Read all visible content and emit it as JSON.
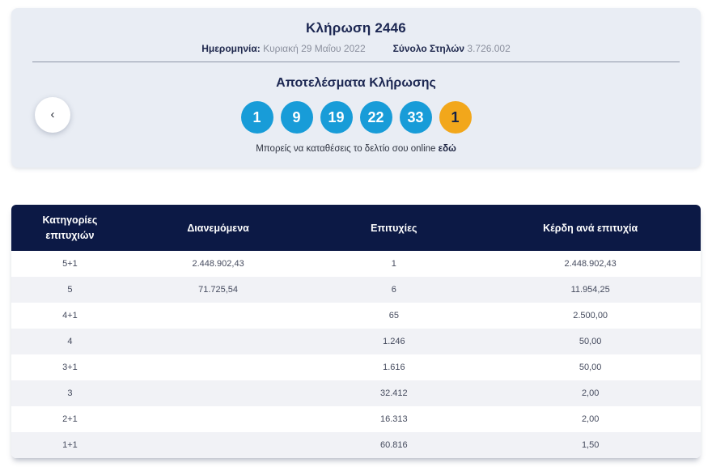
{
  "colors": {
    "navy": "#0c1945",
    "ball_blue": "#189cd8",
    "ball_orange": "#f2a71b",
    "hero_background": "#e9edf4",
    "row_alternate": "#f1f2f6"
  },
  "hero": {
    "title": "Κλήρωση 2446",
    "date_label": "Ημερομηνία:",
    "date_value": "Κυριακή 29 Μαΐου 2022",
    "columns_label": "Σύνολο Στηλών",
    "columns_value": "3.726.002",
    "results_title": "Αποτελέσματα Κλήρωσης",
    "numbers": [
      {
        "value": "1",
        "type": "main"
      },
      {
        "value": "9",
        "type": "main"
      },
      {
        "value": "19",
        "type": "main"
      },
      {
        "value": "22",
        "type": "main"
      },
      {
        "value": "33",
        "type": "main"
      },
      {
        "value": "1",
        "type": "joker"
      }
    ],
    "online_text": "Μπορείς να καταθέσεις το δελτίο σου online",
    "online_link_label": "εδώ",
    "prev_arrow_glyph": "‹"
  },
  "table": {
    "headers": [
      "Κατηγορίες επιτυχιών",
      "Διανεμόμενα",
      "Επιτυχίες",
      "Κέρδη ανά επιτυχία"
    ],
    "rows": [
      {
        "category": "5+1",
        "distributed": "2.448.902,43",
        "winners": "1",
        "prize": "2.448.902,43"
      },
      {
        "category": "5",
        "distributed": "71.725,54",
        "winners": "6",
        "prize": "11.954,25"
      },
      {
        "category": "4+1",
        "distributed": "",
        "winners": "65",
        "prize": "2.500,00"
      },
      {
        "category": "4",
        "distributed": "",
        "winners": "1.246",
        "prize": "50,00"
      },
      {
        "category": "3+1",
        "distributed": "",
        "winners": "1.616",
        "prize": "50,00"
      },
      {
        "category": "3",
        "distributed": "",
        "winners": "32.412",
        "prize": "2,00"
      },
      {
        "category": "2+1",
        "distributed": "",
        "winners": "16.313",
        "prize": "2,00"
      },
      {
        "category": "1+1",
        "distributed": "",
        "winners": "60.816",
        "prize": "1,50"
      }
    ]
  }
}
